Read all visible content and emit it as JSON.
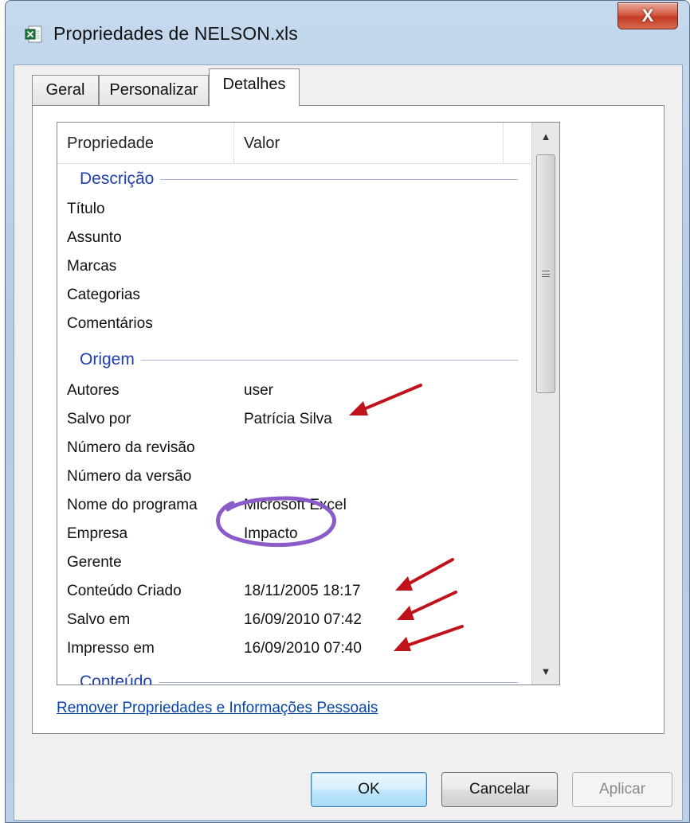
{
  "window": {
    "title": "Propriedades de NELSON.xls",
    "close_label": "X"
  },
  "tabs": [
    {
      "label": "Geral"
    },
    {
      "label": "Personalizar"
    },
    {
      "label": "Detalhes",
      "selected": true
    }
  ],
  "list": {
    "col_property": "Propriedade",
    "col_value": "Valor",
    "groups": {
      "descricao": "Descrição",
      "origem": "Origem",
      "conteudo": "Conteúdo"
    },
    "rows": [
      {
        "property": "Título",
        "value": ""
      },
      {
        "property": "Assunto",
        "value": ""
      },
      {
        "property": "Marcas",
        "value": ""
      },
      {
        "property": "Categorias",
        "value": ""
      },
      {
        "property": "Comentários",
        "value": ""
      },
      {
        "property": "Autores",
        "value": "user"
      },
      {
        "property": "Salvo por",
        "value": "Patrícia Silva"
      },
      {
        "property": "Número da revisão",
        "value": ""
      },
      {
        "property": "Número da versão",
        "value": ""
      },
      {
        "property": "Nome do programa",
        "value": "Microsoft Excel"
      },
      {
        "property": "Empresa",
        "value": "Impacto"
      },
      {
        "property": "Gerente",
        "value": ""
      },
      {
        "property": "Conteúdo Criado",
        "value": "18/11/2005 18:17"
      },
      {
        "property": "Salvo em",
        "value": "16/09/2010 07:42"
      },
      {
        "property": "Impresso em",
        "value": "16/09/2010 07:40"
      }
    ]
  },
  "remove_link": "Remover Propriedades e Informações Pessoais",
  "buttons": {
    "ok": "OK",
    "cancel": "Cancelar",
    "apply": "Aplicar"
  },
  "icons": {
    "title": "excel-file-icon",
    "scroll_up": "scroll-up-arrow-icon",
    "scroll_down": "scroll-down-arrow-icon"
  },
  "colors": {
    "group_header": "#1e3fae",
    "link": "#0645ad",
    "annotation_arrow": "#c0121b",
    "annotation_circle": "#8b5cc9",
    "close_button": "#c23b24"
  }
}
